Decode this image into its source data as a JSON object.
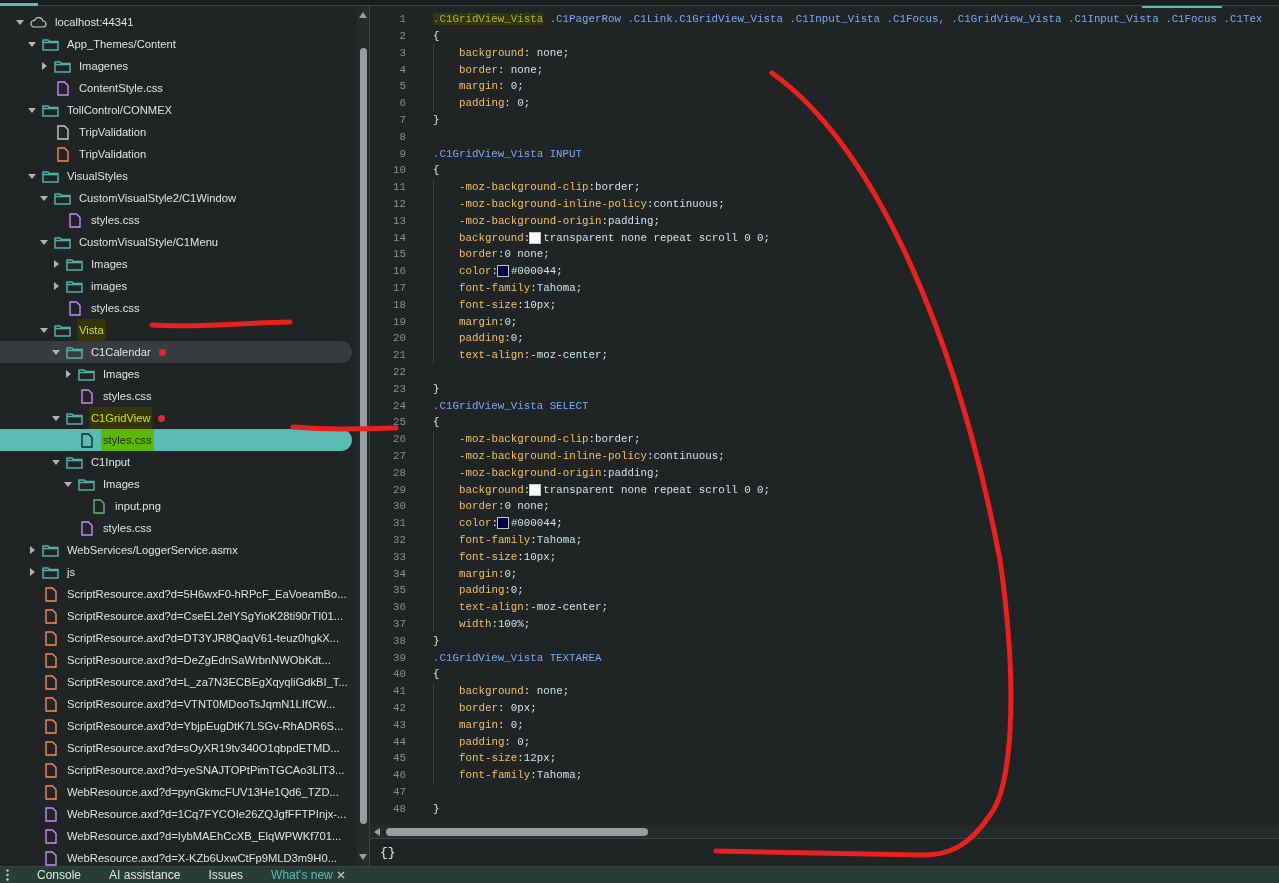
{
  "tree": [
    {
      "label": "localhost:44341",
      "kind": "host",
      "expanded": true,
      "selected": false,
      "hovered": false,
      "highlighted": false,
      "children": [
        {
          "label": "App_Themes/Content",
          "kind": "folder",
          "expanded": true,
          "selected": false,
          "hovered": false,
          "highlighted": false,
          "children": [
            {
              "label": "Imagenes",
              "kind": "folder",
              "expanded": false,
              "selected": false,
              "hovered": false,
              "highlighted": false
            },
            {
              "label": "ContentStyle.css",
              "kind": "css",
              "selected": false,
              "hovered": false,
              "highlighted": false
            }
          ]
        },
        {
          "label": "TollControl/CONMEX",
          "kind": "folder",
          "expanded": true,
          "selected": false,
          "hovered": false,
          "highlighted": false,
          "children": [
            {
              "label": "TripValidation",
              "kind": "doc",
              "selected": false,
              "hovered": false,
              "highlighted": false
            },
            {
              "label": "TripValidation",
              "kind": "script",
              "selected": false,
              "hovered": false,
              "highlighted": false
            }
          ]
        },
        {
          "label": "VisualStyles",
          "kind": "folder",
          "expanded": true,
          "selected": false,
          "hovered": false,
          "highlighted": false,
          "children": [
            {
              "label": "CustomVisualStyle2/C1Window",
              "kind": "folder",
              "expanded": true,
              "selected": false,
              "hovered": false,
              "highlighted": false,
              "children": [
                {
                  "label": "styles.css",
                  "kind": "css",
                  "selected": false,
                  "hovered": false,
                  "highlighted": false
                }
              ]
            },
            {
              "label": "CustomVisualStyle/C1Menu",
              "kind": "folder",
              "expanded": true,
              "selected": false,
              "hovered": false,
              "highlighted": false,
              "children": [
                {
                  "label": "Images",
                  "kind": "folder",
                  "expanded": false,
                  "selected": false,
                  "hovered": false,
                  "highlighted": false
                },
                {
                  "label": "images",
                  "kind": "folder",
                  "expanded": false,
                  "selected": false,
                  "hovered": false,
                  "highlighted": false
                },
                {
                  "label": "styles.css",
                  "kind": "css",
                  "selected": false,
                  "hovered": false,
                  "highlighted": false
                }
              ]
            },
            {
              "label": "Vista",
              "kind": "folder",
              "expanded": true,
              "selected": false,
              "hovered": false,
              "highlighted": true,
              "children": [
                {
                  "label": "C1Calendar",
                  "kind": "folder",
                  "expanded": true,
                  "selected": false,
                  "hovered": true,
                  "highlighted": false,
                  "dot": true,
                  "children": [
                    {
                      "label": "Images",
                      "kind": "folder",
                      "expanded": false,
                      "selected": false,
                      "hovered": false,
                      "highlighted": false
                    },
                    {
                      "label": "styles.css",
                      "kind": "css",
                      "selected": false,
                      "hovered": false,
                      "highlighted": false
                    }
                  ]
                },
                {
                  "label": "C1GridView",
                  "kind": "folder",
                  "expanded": true,
                  "selected": false,
                  "hovered": false,
                  "highlighted": true,
                  "dot": true,
                  "children": [
                    {
                      "label": "styles.css",
                      "kind": "css",
                      "selected": true,
                      "hovered": false,
                      "highlighted": true
                    }
                  ]
                },
                {
                  "label": "C1Input",
                  "kind": "folder",
                  "expanded": true,
                  "selected": false,
                  "hovered": false,
                  "highlighted": false,
                  "children": [
                    {
                      "label": "Images",
                      "kind": "folder",
                      "expanded": true,
                      "selected": false,
                      "hovered": false,
                      "highlighted": false,
                      "children": [
                        {
                          "label": "input.png",
                          "kind": "image",
                          "selected": false,
                          "hovered": false,
                          "highlighted": false
                        }
                      ]
                    },
                    {
                      "label": "styles.css",
                      "kind": "css",
                      "selected": false,
                      "hovered": false,
                      "highlighted": false
                    }
                  ]
                }
              ]
            }
          ]
        },
        {
          "label": "WebServices/LoggerService.asmx",
          "kind": "folder",
          "expanded": false,
          "selected": false,
          "hovered": false,
          "highlighted": false
        },
        {
          "label": "js",
          "kind": "folder",
          "expanded": false,
          "selected": false,
          "hovered": false,
          "highlighted": false
        },
        {
          "label": "ScriptResource.axd?d=5H6wxF0-hRPcF_EaVoeamBo...",
          "kind": "script",
          "selected": false,
          "hovered": false,
          "highlighted": false
        },
        {
          "label": "ScriptResource.axd?d=CseEL2eIYSgYioK28ti90rTI01...",
          "kind": "script",
          "selected": false,
          "hovered": false,
          "highlighted": false
        },
        {
          "label": "ScriptResource.axd?d=DT3YJR8QaqV61-teuz0hgkX...",
          "kind": "script",
          "selected": false,
          "hovered": false,
          "highlighted": false
        },
        {
          "label": "ScriptResource.axd?d=DeZgEdnSaWrbnNWObKdt...",
          "kind": "script",
          "selected": false,
          "hovered": false,
          "highlighted": false
        },
        {
          "label": "ScriptResource.axd?d=L_za7N3ECBEgXqyqliGdkBI_T...",
          "kind": "script",
          "selected": false,
          "hovered": false,
          "highlighted": false
        },
        {
          "label": "ScriptResource.axd?d=VTNT0MDooTsJqmN1LIfCW...",
          "kind": "script",
          "selected": false,
          "hovered": false,
          "highlighted": false
        },
        {
          "label": "ScriptResource.axd?d=YbjpEugDtK7LSGv-RhADR6S...",
          "kind": "script",
          "selected": false,
          "hovered": false,
          "highlighted": false
        },
        {
          "label": "ScriptResource.axd?d=sOyXR19tv340O1qbpdETMD...",
          "kind": "script",
          "selected": false,
          "hovered": false,
          "highlighted": false
        },
        {
          "label": "ScriptResource.axd?d=yeSNAJTOPtPimTGCAo3LIT3...",
          "kind": "script",
          "selected": false,
          "hovered": false,
          "highlighted": false
        },
        {
          "label": "WebResource.axd?d=pynGkmcFUV13He1Qd6_TZD...",
          "kind": "script",
          "selected": false,
          "hovered": false,
          "highlighted": false
        },
        {
          "label": "WebResource.axd?d=1Cq7FYCOIe26ZQJgfFFTPInjx-...",
          "kind": "css",
          "selected": false,
          "hovered": false,
          "highlighted": false
        },
        {
          "label": "WebResource.axd?d=IybMAEhCcXB_ElqWPWKf701...",
          "kind": "css",
          "selected": false,
          "hovered": false,
          "highlighted": false
        },
        {
          "label": "WebResource.axd?d=X-KZb6UxwCtFp9MLD3m9H0...",
          "kind": "css",
          "selected": false,
          "hovered": false,
          "highlighted": false
        }
      ]
    }
  ],
  "code": [
    {
      "n": "1",
      "kind": "selector",
      "parts": [
        {
          "text": ".C1GridView_Vista",
          "highlighted": true
        },
        {
          "text": " .C1PagerRow .C1Link.C1GridView_Vista .C1Input_Vista .C1Focus, .C1GridView_Vista .C1Input_Vista .C1Focus .C1Tex",
          "highlighted": false
        }
      ]
    },
    {
      "n": "2",
      "kind": "brace",
      "text": "{"
    },
    {
      "n": "3",
      "kind": "decl",
      "property": "background",
      "sep": ": ",
      "value": "none;"
    },
    {
      "n": "4",
      "kind": "decl",
      "property": "border",
      "sep": ": ",
      "value": "none;"
    },
    {
      "n": "5",
      "kind": "decl",
      "property": "margin",
      "sep": ": ",
      "value": "0;"
    },
    {
      "n": "6",
      "kind": "decl",
      "property": "padding",
      "sep": ": ",
      "value": "0;"
    },
    {
      "n": "7",
      "kind": "brace",
      "text": "}"
    },
    {
      "n": "8",
      "kind": "blank"
    },
    {
      "n": "9",
      "kind": "selector",
      "parts": [
        {
          "text": ".C1GridView_Vista INPUT",
          "highlighted": false
        }
      ]
    },
    {
      "n": "10",
      "kind": "brace",
      "text": "{"
    },
    {
      "n": "11",
      "kind": "decl",
      "property": "-moz-background-clip",
      "sep": ":",
      "value": "border;"
    },
    {
      "n": "12",
      "kind": "decl",
      "property": "-moz-background-inline-policy",
      "sep": ":",
      "value": "continuous;"
    },
    {
      "n": "13",
      "kind": "decl",
      "property": "-moz-background-origin",
      "sep": ":",
      "value": "padding;"
    },
    {
      "n": "14",
      "kind": "decl",
      "property": "background",
      "sep": ":",
      "color": "#ffffff",
      "value": "transparent none repeat scroll 0 0;"
    },
    {
      "n": "15",
      "kind": "decl",
      "property": "border",
      "sep": ":",
      "value": "0 none;"
    },
    {
      "n": "16",
      "kind": "decl",
      "property": "color",
      "sep": ":",
      "color": "#000044",
      "value": "#000044;"
    },
    {
      "n": "17",
      "kind": "decl",
      "property": "font-family",
      "sep": ":",
      "value": "Tahoma;"
    },
    {
      "n": "18",
      "kind": "decl",
      "property": "font-size",
      "sep": ":",
      "value": "10px;"
    },
    {
      "n": "19",
      "kind": "decl",
      "property": "margin",
      "sep": ":",
      "value": "0;"
    },
    {
      "n": "20",
      "kind": "decl",
      "property": "padding",
      "sep": ":",
      "value": "0;"
    },
    {
      "n": "21",
      "kind": "decl",
      "property": "text-align",
      "sep": ":",
      "value": "-moz-center;"
    },
    {
      "n": "22",
      "kind": "blank"
    },
    {
      "n": "23",
      "kind": "brace",
      "text": "}"
    },
    {
      "n": "24",
      "kind": "selector",
      "parts": [
        {
          "text": ".C1GridView_Vista SELECT",
          "highlighted": false
        }
      ]
    },
    {
      "n": "25",
      "kind": "brace",
      "text": "{"
    },
    {
      "n": "26",
      "kind": "decl",
      "property": "-moz-background-clip",
      "sep": ":",
      "value": "border;"
    },
    {
      "n": "27",
      "kind": "decl",
      "property": "-moz-background-inline-policy",
      "sep": ":",
      "value": "continuous;"
    },
    {
      "n": "28",
      "kind": "decl",
      "property": "-moz-background-origin",
      "sep": ":",
      "value": "padding;"
    },
    {
      "n": "29",
      "kind": "decl",
      "property": "background",
      "sep": ":",
      "color": "#ffffff",
      "value": "transparent none repeat scroll 0 0;"
    },
    {
      "n": "30",
      "kind": "decl",
      "property": "border",
      "sep": ":",
      "value": "0 none;"
    },
    {
      "n": "31",
      "kind": "decl",
      "property": "color",
      "sep": ":",
      "color": "#000044",
      "value": "#000044;"
    },
    {
      "n": "32",
      "kind": "decl",
      "property": "font-family",
      "sep": ":",
      "value": "Tahoma;"
    },
    {
      "n": "33",
      "kind": "decl",
      "property": "font-size",
      "sep": ":",
      "value": "10px;"
    },
    {
      "n": "34",
      "kind": "decl",
      "property": "margin",
      "sep": ":",
      "value": "0;"
    },
    {
      "n": "35",
      "kind": "decl",
      "property": "padding",
      "sep": ":",
      "value": "0;"
    },
    {
      "n": "36",
      "kind": "decl",
      "property": "text-align",
      "sep": ":",
      "value": "-moz-center;"
    },
    {
      "n": "37",
      "kind": "decl",
      "property": "width",
      "sep": ":",
      "value": "100%;"
    },
    {
      "n": "38",
      "kind": "brace",
      "text": "}"
    },
    {
      "n": "39",
      "kind": "selector",
      "parts": [
        {
          "text": ".C1GridView_Vista TEXTAREA",
          "highlighted": false
        }
      ]
    },
    {
      "n": "40",
      "kind": "brace",
      "text": "{"
    },
    {
      "n": "41",
      "kind": "decl",
      "property": "background",
      "sep": ": ",
      "value": "none;"
    },
    {
      "n": "42",
      "kind": "decl",
      "property": "border",
      "sep": ": ",
      "value": "0px;"
    },
    {
      "n": "43",
      "kind": "decl",
      "property": "margin",
      "sep": ": ",
      "value": "0;"
    },
    {
      "n": "44",
      "kind": "decl",
      "property": "padding",
      "sep": ": ",
      "value": "0;"
    },
    {
      "n": "45",
      "kind": "decl",
      "property": "font-size",
      "sep": ":",
      "value": "12px;"
    },
    {
      "n": "46",
      "kind": "decl",
      "property": "font-family",
      "sep": ":",
      "value": "Tahoma;"
    },
    {
      "n": "47",
      "kind": "blank"
    },
    {
      "n": "48",
      "kind": "brace",
      "text": "}"
    }
  ],
  "status_bar": {
    "pretty_print": "{}"
  },
  "drawer_tabs": [
    {
      "label": "Console",
      "selected": false,
      "closable": false
    },
    {
      "label": "AI assistance",
      "selected": false,
      "closable": false
    },
    {
      "label": "Issues",
      "selected": false,
      "closable": false
    },
    {
      "label": "What's new",
      "selected": true,
      "closable": true
    }
  ]
}
